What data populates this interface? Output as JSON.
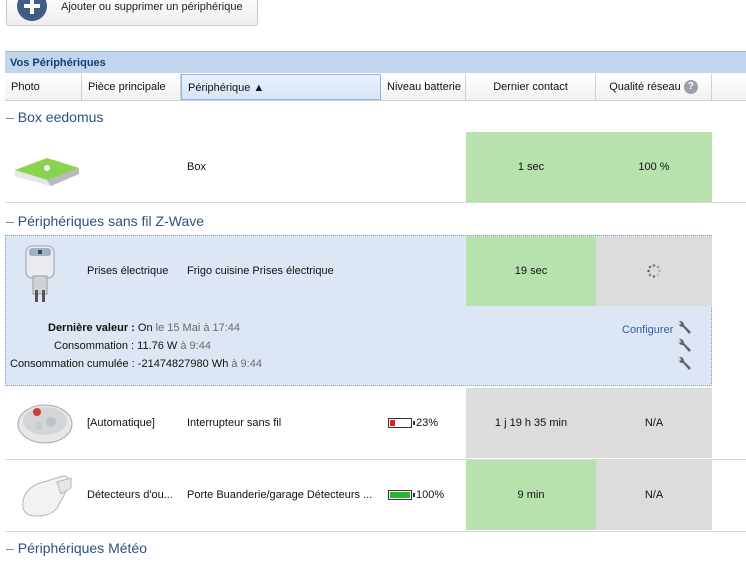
{
  "toolbar": {
    "add_label": "Ajouter ou supprimer un périphérique"
  },
  "panel": {
    "title": "Vos Périphériques"
  },
  "columns": {
    "photo": "Photo",
    "room": "Pièce principale",
    "device": "Périphérique ▲",
    "battery": "Niveau batterie",
    "last_contact": "Dernier contact",
    "network": "Qualité réseau"
  },
  "groups": [
    {
      "label": "Box eedomus"
    },
    {
      "label": "Périphériques sans fil Z-Wave"
    },
    {
      "label": "Périphériques Météo"
    }
  ],
  "rows": [
    {
      "room": "",
      "device": "Box",
      "battery": "",
      "last_contact": "1 sec",
      "network": "100 %"
    },
    {
      "room": "Prises électrique",
      "device": "Frigo cuisine Prises électrique",
      "battery": "",
      "last_contact": "19 sec",
      "network": ""
    },
    {
      "room": "[Automatique]",
      "device": "Interrupteur sans fil",
      "battery": "23%",
      "last_contact": "1 j 19 h 35 min",
      "network": "N/A"
    },
    {
      "room": "Détecteurs d'ou...",
      "device": "Porte Buanderie/garage Détecteurs ...",
      "battery": "100%",
      "last_contact": "9 min",
      "network": "N/A"
    }
  ],
  "battery_levels": {
    "row3": 0.23,
    "row4": 1.0
  },
  "details": {
    "last_value_label": "Dernière valeur :",
    "last_value": "On",
    "last_value_time": "le 15 Mai à 17:44",
    "consumption_label": "Consommation :",
    "consumption": "11.76 W",
    "consumption_time": "à 9:44",
    "cumulative_label": "Consommation cumulée :",
    "cumulative": "-21474827980 Wh",
    "cumulative_time": "à 9:44",
    "configure": "Configurer"
  },
  "colors": {
    "green": "#b7e2ae",
    "grey": "#dcdcdc",
    "header": "#c2d5ee",
    "link": "#2f5ea8"
  },
  "icons": [
    "add-icon",
    "help-icon",
    "wrench-icon",
    "spinner-icon",
    "battery-icon"
  ]
}
